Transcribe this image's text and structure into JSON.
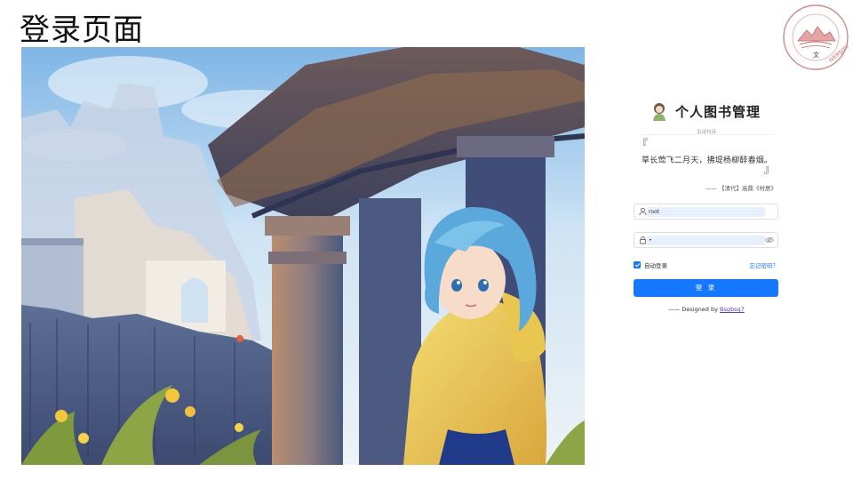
{
  "slide": {
    "title": "登录页面"
  },
  "seal": {
    "text": "IVERSITY",
    "accent": "#c8686a"
  },
  "login": {
    "app_title": "个人图书管理",
    "tagline": "古诗句诗",
    "quote": {
      "open_mark": "『",
      "text": "草长莺飞二月天，拂堤杨柳醉春烟。",
      "close_mark": "』",
      "source": "—— 【清代】高鼎《村居》"
    },
    "username": {
      "icon": "user-icon",
      "value": "root"
    },
    "password": {
      "icon": "lock-icon",
      "value": "•",
      "toggle_icon": "eye-icon"
    },
    "remember_label": "自动登录",
    "remember_checked": true,
    "forgot_label": "忘记密码？",
    "submit_label": "登 录",
    "credit_prefix": "—— Designed by ",
    "credit_author": "Bsgbsg7"
  },
  "colors": {
    "primary": "#1677ff",
    "autofill": "#e8f0fe"
  }
}
